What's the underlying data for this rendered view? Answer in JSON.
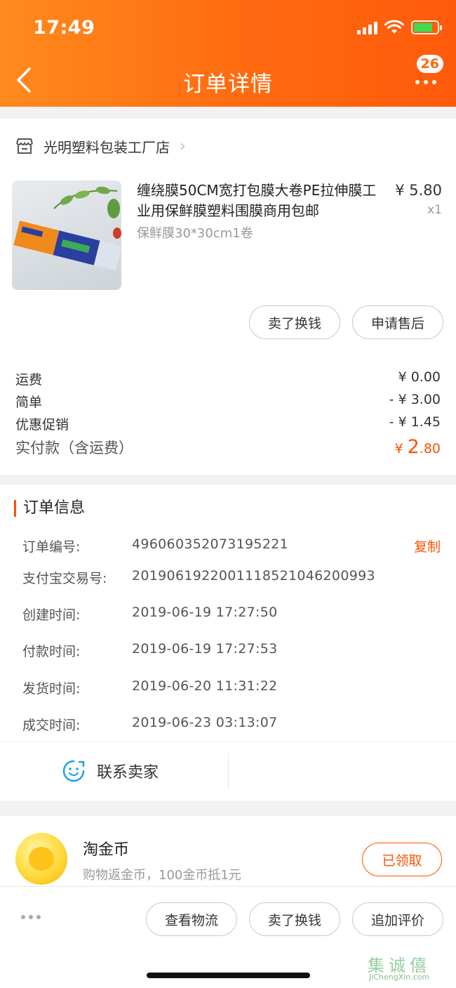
{
  "status_bar": {
    "time": "17:49"
  },
  "nav": {
    "title": "订单详情",
    "badge_count": "26"
  },
  "shop": {
    "name": "光明塑料包装工厂店"
  },
  "product": {
    "title": "缠绕膜50CM宽打包膜大卷PE拉伸膜工业用保鲜膜塑料围膜商用包邮",
    "spec": "保鲜膜30*30cm1卷",
    "price": "¥ 5.80",
    "qty": "x1",
    "actions": {
      "sell": "卖了换钱",
      "after_sale": "申请售后"
    }
  },
  "fees": [
    {
      "label": "运费",
      "value": "¥ 0.00"
    },
    {
      "label": "简单",
      "value": "- ¥ 3.00"
    },
    {
      "label": "优惠促销",
      "value": "- ¥ 1.45"
    }
  ],
  "total": {
    "label": "实付款（含运费）",
    "currency": "¥ ",
    "int": "2",
    "dec": ".80"
  },
  "order_info": {
    "title": "订单信息",
    "copy_label": "复制",
    "rows": [
      {
        "label": "订单编号:",
        "value": "496060352073195221"
      },
      {
        "label": "支付宝交易号:",
        "value": "2019061922001118521046200993"
      },
      {
        "label": "创建时间:",
        "value": "2019-06-19 17:27:50"
      },
      {
        "label": "付款时间:",
        "value": "2019-06-19 17:27:53"
      },
      {
        "label": "发货时间:",
        "value": "2019-06-20 11:31:22"
      },
      {
        "label": "成交时间:",
        "value": "2019-06-23 03:13:07"
      }
    ],
    "contact_label": "联系卖家"
  },
  "coins": {
    "title": "淘金币",
    "subtitle": "购物返金币，100金币抵1元",
    "button": "已领取"
  },
  "bottom_actions": {
    "logistics": "查看物流",
    "sell": "卖了换钱",
    "review": "追加评价"
  },
  "watermark": {
    "top": "集诚僖",
    "bottom": "JiChengXin.com"
  },
  "colors": {
    "accent": "#ff5000",
    "header_start": "#ff8a1d",
    "header_end": "#ff5a0a"
  }
}
